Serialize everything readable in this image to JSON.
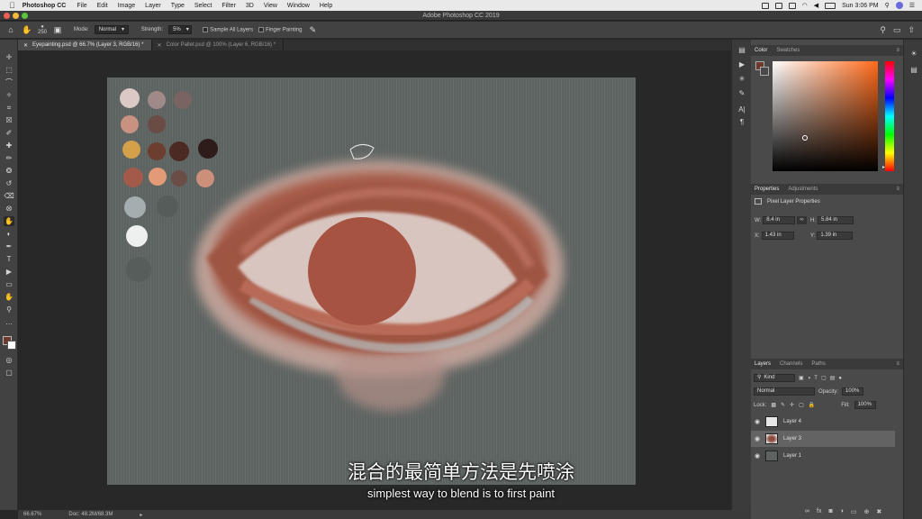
{
  "menubar": {
    "apple": "",
    "app_name": "Photoshop CC",
    "items": [
      "File",
      "Edit",
      "Image",
      "Layer",
      "Type",
      "Select",
      "Filter",
      "3D",
      "View",
      "Window",
      "Help"
    ],
    "clock": "Sun 3:06 PM"
  },
  "window": {
    "title": "Adobe Photoshop CC 2019"
  },
  "options": {
    "brush_size": "250",
    "mode_label": "Mode:",
    "mode_value": "Normal",
    "strength_label": "Strength:",
    "strength_value": "5%",
    "sample_all_layers": "Sample All Layers",
    "finger_painting": "Finger Painting"
  },
  "tabs": [
    {
      "label": "Eyepainting.psd @ 66.7% (Layer 3, RGB/16) *",
      "active": true
    },
    {
      "label": "Color Pallet.psd @ 100% (Layer 6, RGB/16) *",
      "active": false
    }
  ],
  "status": {
    "zoom": "66.67%",
    "doc": "Doc: 48.2M/68.3M"
  },
  "color_panel": {
    "tabs": [
      "Color",
      "Swatches"
    ],
    "active": "Color"
  },
  "properties_panel": {
    "tabs": [
      "Properties",
      "Adjustments"
    ],
    "section": "Pixel Layer Properties",
    "w_label": "W:",
    "w_value": "8.4 in",
    "h_label": "H:",
    "h_value": "5.84 in",
    "x_label": "X:",
    "x_value": "1.43 in",
    "y_label": "Y:",
    "y_value": "1.39 in"
  },
  "layers_panel": {
    "tabs": [
      "Layers",
      "Channels",
      "Paths"
    ],
    "kind": "Kind",
    "blend_mode": "Normal",
    "opacity_label": "Opacity:",
    "opacity_value": "100%",
    "lock_label": "Lock:",
    "fill_label": "Fill:",
    "fill_value": "100%",
    "layers": [
      {
        "name": "Layer 4",
        "selected": false
      },
      {
        "name": "Layer 3",
        "selected": true
      },
      {
        "name": "Layer 1",
        "selected": false
      }
    ]
  },
  "subtitles": {
    "cn": "混合的最简单方法是先喷涂",
    "en": "simplest way to blend is to first paint"
  },
  "colors": {
    "canvas_bg": "#5d6361",
    "iris": "#9c4e3c",
    "skin_red": "#a65a47",
    "highlight": "#e8d9d3"
  }
}
